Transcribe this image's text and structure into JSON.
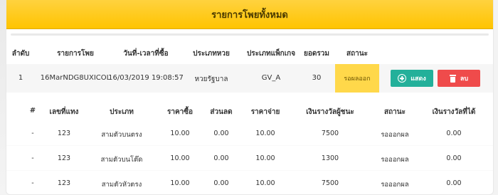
{
  "panel": {
    "title": "รายการโพยทั้งหมด"
  },
  "main_table": {
    "headers": [
      "ลำดับ",
      "รายการโพย",
      "วันที่-เวลาที่ซื้อ",
      "ประเภทหวย",
      "ประเภทแพ็กเกจ",
      "ยอดรวม",
      "สถานะ"
    ],
    "row": {
      "index": "1",
      "slip_id": "16MarNDG8UXICOL",
      "datetime": "16/03/2019 19:08:57",
      "lottery_type": "หวยรัฐบาล",
      "package_type": "GV_A",
      "total": "30",
      "status": "รอผลออก",
      "show_button": "แสดง",
      "delete_button": "ลบ"
    }
  },
  "detail_table": {
    "headers": [
      "#",
      "เลขที่แทง",
      "ประเภท",
      "ราคาซื้อ",
      "ส่วนลด",
      "ราคาจ่าย",
      "เงินรางวัลผู้ชนะ",
      "สถานะ",
      "เงินรางวัลที่ได้"
    ],
    "rows": [
      [
        "-",
        "123",
        "สามตัวบนตรง",
        "10.00",
        "0.00",
        "10.00",
        "7500",
        "รอออกผล",
        "0.00"
      ],
      [
        "-",
        "123",
        "สามตัวบนโต๊ด",
        "10.00",
        "0.00",
        "10.00",
        "1300",
        "รอออกผล",
        "0.00"
      ],
      [
        "-",
        "123",
        "สามตัวหัวตรง",
        "10.00",
        "0.00",
        "10.00",
        "7500",
        "รอออกผล",
        "0.00"
      ]
    ]
  },
  "colors": {
    "header_gold": "#ffc400",
    "status_yellow": "#ffd84a",
    "show_teal": "#23b09a",
    "delete_red": "#ef4b4b"
  },
  "icons": {
    "show": "circle-plus-icon",
    "delete": "trash-icon"
  }
}
